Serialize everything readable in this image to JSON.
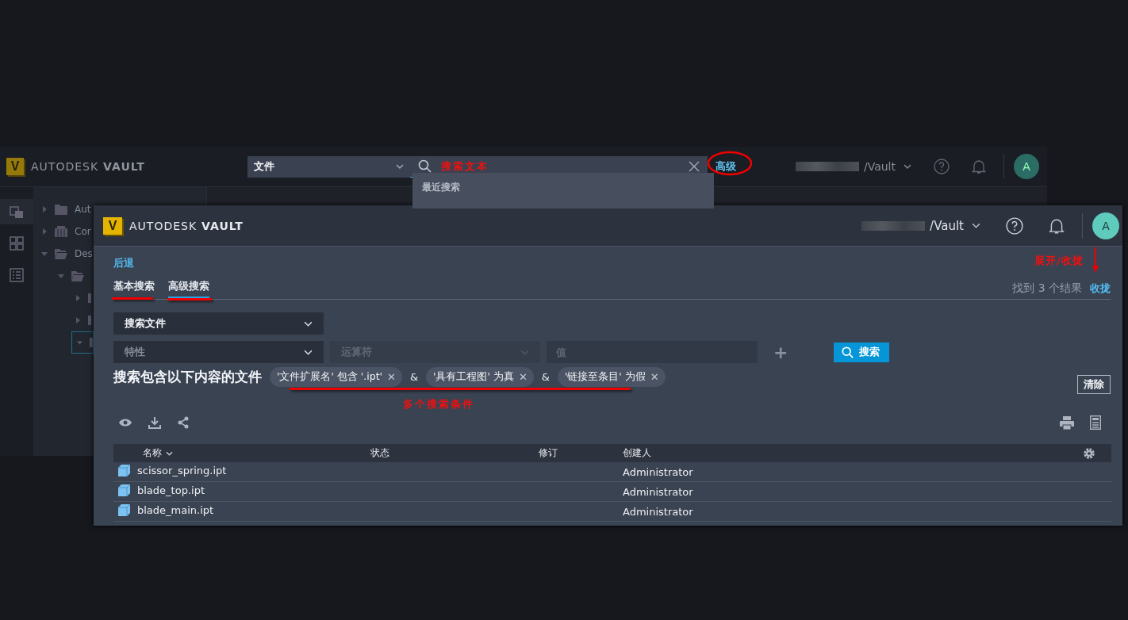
{
  "back_window": {
    "brand": {
      "logo": "V",
      "company": "AUTODESK",
      "product": "VAULT"
    },
    "search": {
      "scope": "文件",
      "annotation": "搜索文本",
      "advanced_link": "高级"
    },
    "recent": {
      "heading": "最近搜索"
    },
    "server": "/Vault",
    "avatar": "A",
    "rail": [
      {
        "selected": true
      },
      {
        "selected": false
      },
      {
        "selected": false
      }
    ],
    "tree": [
      {
        "kind": "folder",
        "label": "Aut",
        "expanded": false,
        "selected": false
      },
      {
        "kind": "library",
        "label": "Cor",
        "expanded": false,
        "selected": false
      },
      {
        "kind": "folder",
        "label": "Des",
        "expanded": true,
        "selected": false,
        "children": [
          {
            "kind": "folder",
            "expanded": true,
            "selected": false,
            "children": [
              {
                "kind": "item",
                "expanded": false,
                "selected": false
              },
              {
                "kind": "item",
                "expanded": false,
                "selected": false
              },
              {
                "kind": "item",
                "expanded": true,
                "selected": true
              }
            ]
          }
        ]
      }
    ]
  },
  "window": {
    "brand": {
      "logo": "V",
      "company": "AUTODESK",
      "product": "VAULT"
    },
    "server": "/Vault",
    "avatar": "A",
    "back_link": "后退",
    "tabs": [
      {
        "label": "基本搜索",
        "selected": false
      },
      {
        "label": "高级搜索",
        "selected": true
      }
    ],
    "result_count": "找到 3 个结果",
    "collapse_link": "收拢",
    "scope_select": "搜索文件",
    "property_select": {
      "placeholder": "特性"
    },
    "operator_select": {
      "placeholder": "运算符",
      "disabled": true
    },
    "value_field": {
      "placeholder": "值"
    },
    "add_label": "+",
    "search_button": "搜索",
    "criteria_heading": "搜索包含以下内容的文件",
    "criteria": [
      {
        "label": "'文件扩展名' 包含 '.ipt'",
        "remove": "✕"
      },
      {
        "label": "'具有工程图' 为真",
        "remove": "✕"
      },
      {
        "label": "'链接至条目' 为假",
        "remove": "✕"
      }
    ],
    "criteria_joiner": [
      "&",
      "&"
    ],
    "clear_button": "清除",
    "table": {
      "columns": [
        {
          "label": "名称",
          "sorted": true
        },
        {
          "label": "状态",
          "sorted": false
        },
        {
          "label": "修订",
          "sorted": false
        },
        {
          "label": "创建人",
          "sorted": false
        }
      ],
      "rows": [
        {
          "name": "scissor_spring.ipt",
          "creator": "Administrator"
        },
        {
          "name": "blade_top.ipt",
          "creator": "Administrator"
        },
        {
          "name": "blade_main.ipt",
          "creator": "Administrator"
        }
      ]
    }
  },
  "annotations": {
    "expand_note": "展开/收拢",
    "criteria_note": "多个搜索条件"
  }
}
